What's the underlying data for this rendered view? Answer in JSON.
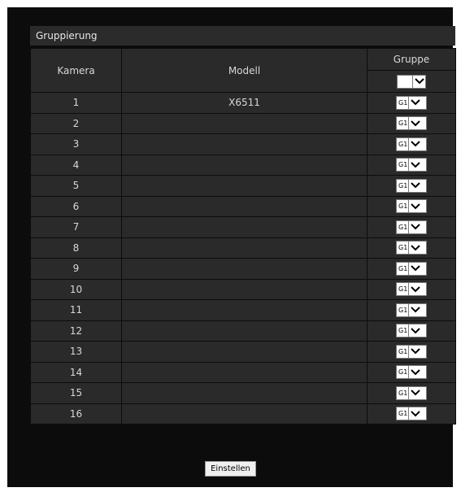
{
  "panel": {
    "title": "Gruppierung"
  },
  "table": {
    "headers": {
      "camera": "Kamera",
      "model": "Modell",
      "group": "Gruppe"
    },
    "group_header_select_value": "",
    "rows": [
      {
        "camera": "1",
        "model": "X6511",
        "group": "G1"
      },
      {
        "camera": "2",
        "model": "",
        "group": "G1"
      },
      {
        "camera": "3",
        "model": "",
        "group": "G1"
      },
      {
        "camera": "4",
        "model": "",
        "group": "G1"
      },
      {
        "camera": "5",
        "model": "",
        "group": "G1"
      },
      {
        "camera": "6",
        "model": "",
        "group": "G1"
      },
      {
        "camera": "7",
        "model": "",
        "group": "G1"
      },
      {
        "camera": "8",
        "model": "",
        "group": "G1"
      },
      {
        "camera": "9",
        "model": "",
        "group": "G1"
      },
      {
        "camera": "10",
        "model": "",
        "group": "G1"
      },
      {
        "camera": "11",
        "model": "",
        "group": "G1"
      },
      {
        "camera": "12",
        "model": "",
        "group": "G1"
      },
      {
        "camera": "13",
        "model": "",
        "group": "G1"
      },
      {
        "camera": "14",
        "model": "",
        "group": "G1"
      },
      {
        "camera": "15",
        "model": "",
        "group": "G1"
      },
      {
        "camera": "16",
        "model": "",
        "group": "G1"
      }
    ]
  },
  "actions": {
    "submit_label": "Einstellen"
  }
}
